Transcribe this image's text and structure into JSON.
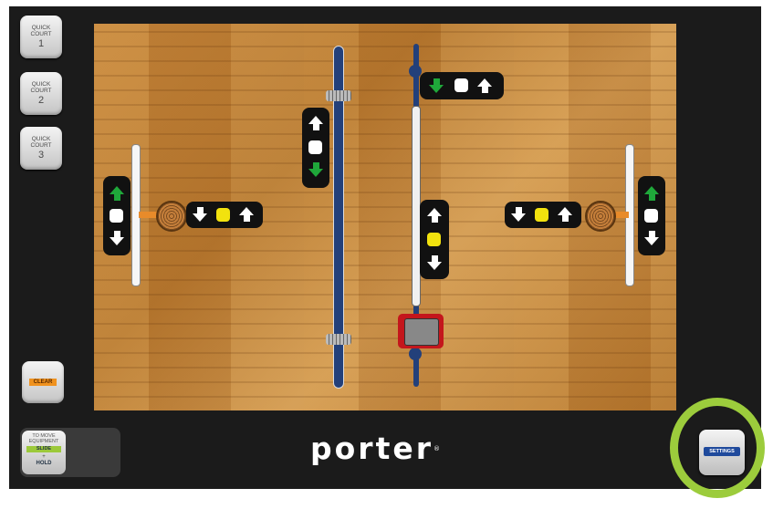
{
  "sidebar": {
    "quick_court_buttons": [
      {
        "label": "QUICK COURT",
        "number": "1"
      },
      {
        "label": "QUICK COURT",
        "number": "2"
      },
      {
        "label": "QUICK COURT",
        "number": "3"
      }
    ],
    "clear_label": "CLEAR"
  },
  "footer": {
    "move_hint_top": "TO MOVE EQUIPMENT",
    "move_hint_slide": "SLIDE",
    "move_hint_plus": "+",
    "move_hint_hold": "HOLD",
    "logo_text": "porter",
    "logo_mark": "®",
    "settings_label": "SETTINGS"
  },
  "colors": {
    "accent_green": "#1fa83a",
    "accent_yellow": "#f2e20e",
    "highlight_ring": "#9ccc3c",
    "settings_blue": "#1f4a9c",
    "clear_orange": "#f0921e"
  },
  "icons": [
    "arrow-up-icon",
    "arrow-down-icon",
    "stop-square-icon",
    "basketball-hoop-icon",
    "volleyball-net-icon",
    "divider-curtain-icon"
  ]
}
